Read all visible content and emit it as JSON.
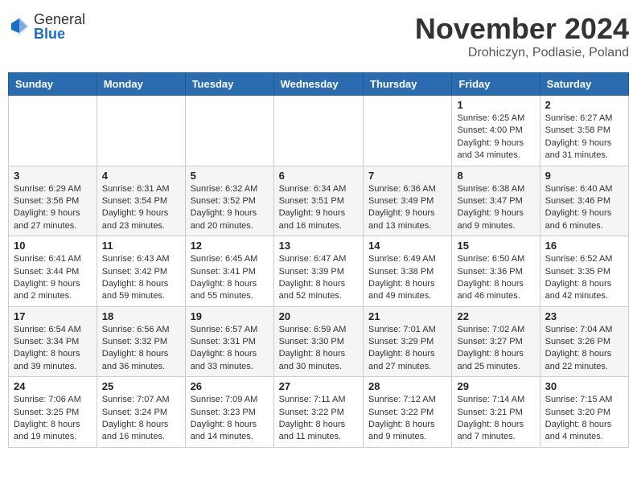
{
  "header": {
    "logo_general": "General",
    "logo_blue": "Blue",
    "month_title": "November 2024",
    "location": "Drohiczyn, Podlasie, Poland"
  },
  "columns": [
    "Sunday",
    "Monday",
    "Tuesday",
    "Wednesday",
    "Thursday",
    "Friday",
    "Saturday"
  ],
  "weeks": [
    {
      "days": [
        {
          "date": "",
          "info": ""
        },
        {
          "date": "",
          "info": ""
        },
        {
          "date": "",
          "info": ""
        },
        {
          "date": "",
          "info": ""
        },
        {
          "date": "",
          "info": ""
        },
        {
          "date": "1",
          "info": "Sunrise: 6:25 AM\nSunset: 4:00 PM\nDaylight: 9 hours and 34 minutes."
        },
        {
          "date": "2",
          "info": "Sunrise: 6:27 AM\nSunset: 3:58 PM\nDaylight: 9 hours and 31 minutes."
        }
      ]
    },
    {
      "days": [
        {
          "date": "3",
          "info": "Sunrise: 6:29 AM\nSunset: 3:56 PM\nDaylight: 9 hours and 27 minutes."
        },
        {
          "date": "4",
          "info": "Sunrise: 6:31 AM\nSunset: 3:54 PM\nDaylight: 9 hours and 23 minutes."
        },
        {
          "date": "5",
          "info": "Sunrise: 6:32 AM\nSunset: 3:52 PM\nDaylight: 9 hours and 20 minutes."
        },
        {
          "date": "6",
          "info": "Sunrise: 6:34 AM\nSunset: 3:51 PM\nDaylight: 9 hours and 16 minutes."
        },
        {
          "date": "7",
          "info": "Sunrise: 6:36 AM\nSunset: 3:49 PM\nDaylight: 9 hours and 13 minutes."
        },
        {
          "date": "8",
          "info": "Sunrise: 6:38 AM\nSunset: 3:47 PM\nDaylight: 9 hours and 9 minutes."
        },
        {
          "date": "9",
          "info": "Sunrise: 6:40 AM\nSunset: 3:46 PM\nDaylight: 9 hours and 6 minutes."
        }
      ]
    },
    {
      "days": [
        {
          "date": "10",
          "info": "Sunrise: 6:41 AM\nSunset: 3:44 PM\nDaylight: 9 hours and 2 minutes."
        },
        {
          "date": "11",
          "info": "Sunrise: 6:43 AM\nSunset: 3:42 PM\nDaylight: 8 hours and 59 minutes."
        },
        {
          "date": "12",
          "info": "Sunrise: 6:45 AM\nSunset: 3:41 PM\nDaylight: 8 hours and 55 minutes."
        },
        {
          "date": "13",
          "info": "Sunrise: 6:47 AM\nSunset: 3:39 PM\nDaylight: 8 hours and 52 minutes."
        },
        {
          "date": "14",
          "info": "Sunrise: 6:49 AM\nSunset: 3:38 PM\nDaylight: 8 hours and 49 minutes."
        },
        {
          "date": "15",
          "info": "Sunrise: 6:50 AM\nSunset: 3:36 PM\nDaylight: 8 hours and 46 minutes."
        },
        {
          "date": "16",
          "info": "Sunrise: 6:52 AM\nSunset: 3:35 PM\nDaylight: 8 hours and 42 minutes."
        }
      ]
    },
    {
      "days": [
        {
          "date": "17",
          "info": "Sunrise: 6:54 AM\nSunset: 3:34 PM\nDaylight: 8 hours and 39 minutes."
        },
        {
          "date": "18",
          "info": "Sunrise: 6:56 AM\nSunset: 3:32 PM\nDaylight: 8 hours and 36 minutes."
        },
        {
          "date": "19",
          "info": "Sunrise: 6:57 AM\nSunset: 3:31 PM\nDaylight: 8 hours and 33 minutes."
        },
        {
          "date": "20",
          "info": "Sunrise: 6:59 AM\nSunset: 3:30 PM\nDaylight: 8 hours and 30 minutes."
        },
        {
          "date": "21",
          "info": "Sunrise: 7:01 AM\nSunset: 3:29 PM\nDaylight: 8 hours and 27 minutes."
        },
        {
          "date": "22",
          "info": "Sunrise: 7:02 AM\nSunset: 3:27 PM\nDaylight: 8 hours and 25 minutes."
        },
        {
          "date": "23",
          "info": "Sunrise: 7:04 AM\nSunset: 3:26 PM\nDaylight: 8 hours and 22 minutes."
        }
      ]
    },
    {
      "days": [
        {
          "date": "24",
          "info": "Sunrise: 7:06 AM\nSunset: 3:25 PM\nDaylight: 8 hours and 19 minutes."
        },
        {
          "date": "25",
          "info": "Sunrise: 7:07 AM\nSunset: 3:24 PM\nDaylight: 8 hours and 16 minutes."
        },
        {
          "date": "26",
          "info": "Sunrise: 7:09 AM\nSunset: 3:23 PM\nDaylight: 8 hours and 14 minutes."
        },
        {
          "date": "27",
          "info": "Sunrise: 7:11 AM\nSunset: 3:22 PM\nDaylight: 8 hours and 11 minutes."
        },
        {
          "date": "28",
          "info": "Sunrise: 7:12 AM\nSunset: 3:22 PM\nDaylight: 8 hours and 9 minutes."
        },
        {
          "date": "29",
          "info": "Sunrise: 7:14 AM\nSunset: 3:21 PM\nDaylight: 8 hours and 7 minutes."
        },
        {
          "date": "30",
          "info": "Sunrise: 7:15 AM\nSunset: 3:20 PM\nDaylight: 8 hours and 4 minutes."
        }
      ]
    }
  ]
}
